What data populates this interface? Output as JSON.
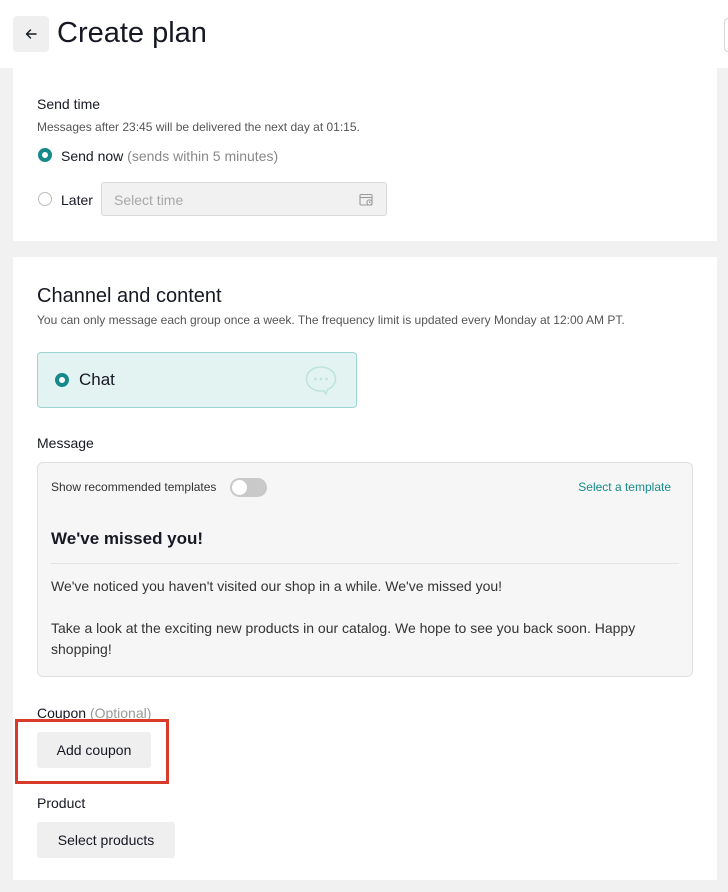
{
  "header": {
    "title": "Create plan"
  },
  "send_time": {
    "label": "Send time",
    "note": "Messages after 23:45 will be delivered the next day at 01:15.",
    "send_now_label": "Send now",
    "send_now_hint": "(sends within 5 minutes)",
    "later_label": "Later",
    "time_placeholder": "Select time",
    "selected": "Send now"
  },
  "channel": {
    "title": "Channel and content",
    "note": "You can only message each group once a week. The frequency limit is updated every Monday at 12:00 AM PT.",
    "options": [
      {
        "label": "Chat",
        "selected": true
      }
    ]
  },
  "message": {
    "label": "Message",
    "templates_toggle_label": "Show recommended templates",
    "templates_toggle_on": false,
    "select_template_label": "Select a template",
    "title": "We've missed you!",
    "body": [
      "We've noticed you haven't visited our shop in a while. We've missed you!",
      "Take a look at the exciting new products in our catalog. We hope to see you back soon. Happy shopping!"
    ]
  },
  "coupon": {
    "label": "Coupon",
    "optional_label": "(Optional)",
    "add_button": "Add coupon"
  },
  "product": {
    "label": "Product",
    "select_button": "Select products"
  },
  "colors": {
    "accent": "#168a8a",
    "chat_bg": "#e3f3f2",
    "highlight": "#d93b2b"
  }
}
